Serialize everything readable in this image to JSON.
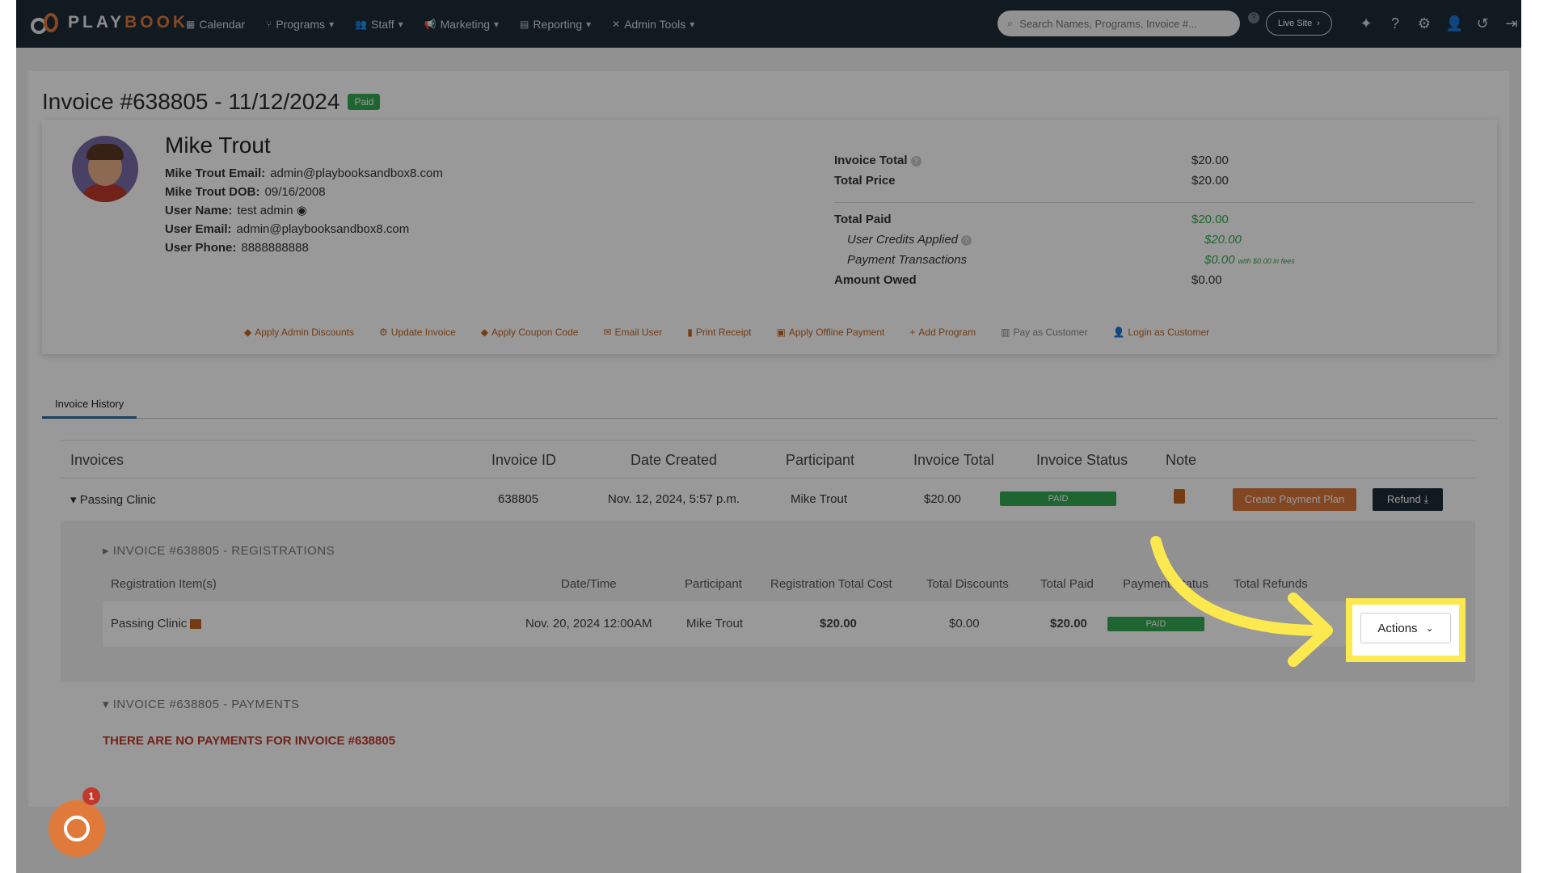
{
  "nav": {
    "logo_a": "PLAY",
    "logo_b": "BOOK",
    "items": [
      {
        "label": "Calendar",
        "icon": "calendar-icon"
      },
      {
        "label": "Programs",
        "icon": "programs-icon"
      },
      {
        "label": "Staff",
        "icon": "staff-icon"
      },
      {
        "label": "Marketing",
        "icon": "megaphone-icon"
      },
      {
        "label": "Reporting",
        "icon": "report-icon"
      },
      {
        "label": "Admin Tools",
        "icon": "tools-icon"
      }
    ],
    "search_placeholder": "Search Names, Programs, Invoice #...",
    "live_site": "Live Site"
  },
  "invoice": {
    "title": "Invoice #638805 - 11/12/2024",
    "status_badge": "Paid"
  },
  "user": {
    "name": "Mike Trout",
    "fields": [
      {
        "key": "Mike Trout Email:",
        "value": "admin@playbooksandbox8.com"
      },
      {
        "key": "Mike Trout DOB:",
        "value": "09/16/2008"
      },
      {
        "key": "User Name:",
        "value": "test admin"
      },
      {
        "key": "User Email:",
        "value": "admin@playbooksandbox8.com"
      },
      {
        "key": "User Phone:",
        "value": "8888888888"
      }
    ]
  },
  "totals": {
    "invoice_total_label": "Invoice Total",
    "invoice_total": "$20.00",
    "total_price_label": "Total Price",
    "total_price": "$20.00",
    "total_paid_label": "Total Paid",
    "total_paid": "$20.00",
    "credits_label": "User Credits Applied",
    "credits": "$20.00",
    "transactions_label": "Payment Transactions",
    "transactions": "$0.00",
    "transactions_fees": "with $0.00 in fees",
    "owed_label": "Amount Owed",
    "owed": "$0.00"
  },
  "actions": [
    "Apply Admin Discounts",
    "Update Invoice",
    "Apply Coupon Code",
    "Email User",
    "Print Receipt",
    "Apply Offline Payment",
    "Add Program",
    "Pay as Customer",
    "Login as Customer"
  ],
  "tabs": {
    "history": "Invoice History"
  },
  "table": {
    "headers": [
      "Invoices",
      "Invoice ID",
      "Date Created",
      "Participant",
      "Invoice Total",
      "Invoice Status",
      "Note"
    ],
    "row": {
      "name": "Passing Clinic",
      "id": "638805",
      "date": "Nov. 12, 2024, 5:57 p.m.",
      "participant": "Mike Trout",
      "total": "$20.00",
      "status": "PAID",
      "plan_button": "Create Payment Plan",
      "refund_button": "Refund"
    }
  },
  "registrations": {
    "title": "INVOICE #638805 - REGISTRATIONS",
    "headers": [
      "Registration Item(s)",
      "Date/Time",
      "Participant",
      "Registration Total Cost",
      "Total Discounts",
      "Total Paid",
      "Payment Status",
      "Total Refunds"
    ],
    "row": {
      "item": "Passing Clinic",
      "datetime": "Nov. 20, 2024 12:00AM",
      "participant": "Mike Trout",
      "cost": "$20.00",
      "discounts": "$0.00",
      "paid": "$20.00",
      "status": "PAID",
      "actions_button": "Actions"
    }
  },
  "payments": {
    "title": "INVOICE #638805 - PAYMENTS",
    "empty": "THERE ARE NO PAYMENTS FOR INVOICE #638805"
  },
  "chat": {
    "badge": "1"
  },
  "colors": {
    "nav_bg": "#1d2b38",
    "accent": "#e07a3a",
    "paid_green": "#34a853",
    "highlight": "#fce94f",
    "arrow": "#fce94f"
  }
}
